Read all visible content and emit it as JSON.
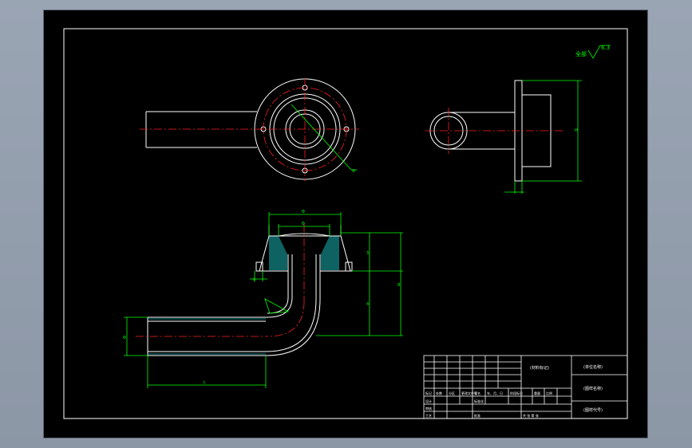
{
  "colors": {
    "background": "#9aa5b4",
    "canvas": "#000000",
    "outline": "#ffffff",
    "dimension": "#00ff00",
    "centerline": "#ff2020",
    "hatch": "#19b3b3",
    "note": "#00ff00"
  },
  "surface_note": {
    "prefix": "全部",
    "value": "6.3"
  },
  "dimensions": {
    "hole_diameter": "Φ",
    "top_width": "Φ",
    "inner_width": "Φ",
    "flange_height": "5",
    "top_height": "3",
    "total_height": "8",
    "pipe_height": "4",
    "pipe_diameter": "Φ",
    "pipe_length": "L",
    "side_height": "H"
  },
  "title_block": {
    "part_name": "(材料标记)",
    "org_name": "(单位名称)",
    "drawing_name": "(图样名称)",
    "drawing_code": "(图样代号)",
    "row_labels": [
      "标记",
      "设计",
      "审核",
      "工艺"
    ],
    "col_labels": [
      "处数",
      "分区",
      "更改文件号",
      "签名",
      "年、月、日"
    ],
    "std_label": "标准化",
    "stage_label": "阶段标记",
    "weight_label": "重量",
    "scale_label": "比例",
    "approve_label": "批准",
    "sheet_label": "共  张  第  张"
  }
}
